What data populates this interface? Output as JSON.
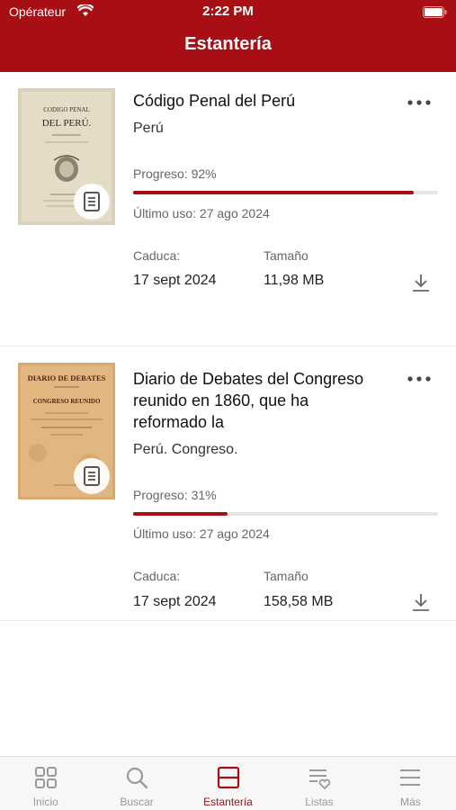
{
  "status": {
    "carrier": "Opérateur",
    "time": "2:22 PM"
  },
  "header": {
    "title": "Estantería"
  },
  "books": [
    {
      "title": "Código Penal del Perú",
      "author": "Perú",
      "progress_label": "Progreso: 92%",
      "progress": 0.92,
      "last_use": "Último uso: 27 ago 2024",
      "expires_label": "Caduca:",
      "expires_value": "17 sept 2024",
      "size_label": "Tamaño",
      "size_value": "11,98 MB",
      "cover": {
        "line1": "CODIGO PENAL",
        "line2": "DEL PERÚ."
      },
      "icons": {
        "more": "more-dots-icon",
        "download": "download-icon",
        "badge": "document-icon"
      }
    },
    {
      "title": "Diario de Debates del Congreso reunido en 1860, que ha reformado la",
      "author": "Perú. Congreso.",
      "progress_label": "Progreso: 31%",
      "progress": 0.31,
      "last_use": "Último uso: 27 ago 2024",
      "expires_label": "Caduca:",
      "expires_value": "17 sept 2024",
      "size_label": "Tamaño",
      "size_value": "158,58 MB",
      "cover": {
        "line1": "DIARIO DE DEBATES",
        "line2": "CONGRESO REUNIDO"
      },
      "icons": {
        "more": "more-dots-icon",
        "download": "download-icon",
        "badge": "document-icon"
      }
    }
  ],
  "tabs": [
    {
      "label": "Inicio",
      "icon": "grid-icon",
      "active": false
    },
    {
      "label": "Buscar",
      "icon": "search-icon",
      "active": false
    },
    {
      "label": "Estantería",
      "icon": "shelf-icon",
      "active": true
    },
    {
      "label": "Listas",
      "icon": "list-heart-icon",
      "active": false
    },
    {
      "label": "Más",
      "icon": "menu-icon",
      "active": false
    }
  ],
  "colors": {
    "brand": "#a80f14",
    "inactive_tab": "#9a9a9a"
  }
}
